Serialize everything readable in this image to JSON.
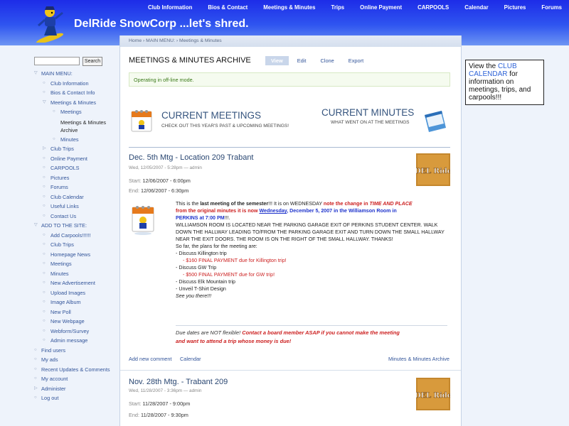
{
  "header": {
    "site_name": "DelRide SnowCorp ...let's shred.",
    "nav": [
      "Club Information",
      "Bios & Contact",
      "Meetings & Minutes",
      "Trips",
      "Online Payment",
      "CARPOOLS",
      "Calendar",
      "Pictures",
      "Forums"
    ]
  },
  "search": {
    "button": "Search",
    "value": ""
  },
  "sidebar": {
    "items": [
      {
        "label": "MAIN MENU:",
        "level": 0,
        "mk": "▽"
      },
      {
        "label": "Club Information",
        "level": 1,
        "mk": "○"
      },
      {
        "label": "Bios & Contact Info",
        "level": 1,
        "mk": "○"
      },
      {
        "label": "Meetings & Minutes",
        "level": 1,
        "mk": "▽"
      },
      {
        "label": "Meetings",
        "level": 2,
        "mk": "○"
      },
      {
        "label": "Meetings & Minutes Archive",
        "level": 2,
        "mk": "",
        "active": true
      },
      {
        "label": "Minutes",
        "level": 2,
        "mk": "○"
      },
      {
        "label": "Club Trips",
        "level": 1,
        "mk": "▷"
      },
      {
        "label": "Online Payment",
        "level": 1,
        "mk": "○"
      },
      {
        "label": "CARPOOLS",
        "level": 1,
        "mk": "○"
      },
      {
        "label": "Pictures",
        "level": 1,
        "mk": "○"
      },
      {
        "label": "Forums",
        "level": 1,
        "mk": "○"
      },
      {
        "label": "Club Calendar",
        "level": 1,
        "mk": "○"
      },
      {
        "label": "Useful Links",
        "level": 1,
        "mk": "○"
      },
      {
        "label": "Contact Us",
        "level": 1,
        "mk": "○"
      },
      {
        "label": "ADD TO THE SITE:",
        "level": 0,
        "mk": "▽"
      },
      {
        "label": "Add Carpools!!!!!!",
        "level": 1,
        "mk": "○"
      },
      {
        "label": "Club Trips",
        "level": 1,
        "mk": "○"
      },
      {
        "label": "Homepage News",
        "level": 1,
        "mk": "○"
      },
      {
        "label": "Meetings",
        "level": 1,
        "mk": "○"
      },
      {
        "label": "Minutes",
        "level": 1,
        "mk": "○"
      },
      {
        "label": "New Advertisement",
        "level": 1,
        "mk": "○"
      },
      {
        "label": "Upload Images",
        "level": 1,
        "mk": "○"
      },
      {
        "label": "Image Album",
        "level": 1,
        "mk": "○"
      },
      {
        "label": "New Poll",
        "level": 1,
        "mk": "○"
      },
      {
        "label": "New Webpage",
        "level": 1,
        "mk": "○"
      },
      {
        "label": "Webform/Survey",
        "level": 1,
        "mk": "○"
      },
      {
        "label": "Admin message",
        "level": 1,
        "mk": "○"
      },
      {
        "label": "Find users",
        "level": 0,
        "mk": "○"
      },
      {
        "label": "My ads",
        "level": 0,
        "mk": "○"
      },
      {
        "label": "Recent Updates & Comments",
        "level": 0,
        "mk": "○"
      },
      {
        "label": "My account",
        "level": 0,
        "mk": "○"
      },
      {
        "label": "Administer",
        "level": 0,
        "mk": "▷"
      },
      {
        "label": "Log out",
        "level": 0,
        "mk": "○"
      }
    ]
  },
  "main": {
    "breadcrumb": "Home › MAIN MENU: › Meetings & Minutes",
    "title": "MEETINGS & MINUTES ARCHIVE",
    "tabs": [
      "View",
      "Edit",
      "Clone",
      "Export"
    ],
    "status": "Operating in off-line mode.",
    "current_meetings": {
      "title": "CURRENT MEETINGS",
      "subtitle": "CHECK OUT THIS YEAR'S PAST & UPCOMING MEETINGS!"
    },
    "current_minutes": {
      "title": "CURRENT MINUTES",
      "subtitle": "WHAT WENT ON AT THE MEETINGS"
    }
  },
  "posts": [
    {
      "title": "Dec. 5th Mtg - Location 209 Trabant",
      "meta": "Wed, 12/05/2007 - 5:28pm — admin",
      "start_label": "Start:",
      "start": "12/06/2007 - 6:00pm",
      "end_label": "End:",
      "end": "12/06/2007 - 6:30pm",
      "logo_text": "DEL Ride",
      "body": {
        "p1a": "This is the ",
        "p1b": "last meeting of the semester",
        "p1c": "!!! It is on WEDNESDAY ",
        "p1d": "note the change in ",
        "p1e": "TIME AND PLACE",
        "p2a": "from the original minutes it is now ",
        "p2b": "Wednesday",
        "p2c": ", December 5, 2007 in the Williamson Room in",
        "p3a": "PERKINS at 7:00 PM",
        "p3b": "!!!.",
        "p4": "WILLIAMSON ROOM IS LOCATED NEAR THE PARKING GARAGE EXIT OF PERKINS STUDENT CENTER. WALK",
        "p5": "DOWN THE HALLWAY LEADING TO/FROM THE PARKING GARAGE EXIT AND TURN DOWN THE SMALL HALLWAY",
        "p6": "NEAR THE EXIT DOORS. THE ROOM IS ON THE RIGHT OF THE SMALL HALLWAY. THANKS!",
        "plans": "So far, the plans for the meeting are:",
        "l1": "- Discuss Killington trip",
        "l2": "- $160 FINAL PAYMENT due for Killington trip!",
        "l3": "- Discuss GW Trip",
        "l4": "- $500 FINAL PAYMENT due for GW trip!",
        "l5": "- Discuss Elk Mountain trip",
        "l6": "- Unveil T-Shirt Design",
        "l7": "See you there!!!",
        "n1a": "Due dates are NOT flexible! ",
        "n1b": "Contact a board member ASAP if you cannot make the meeting",
        "n2": "and want to attend a trip whose money is due!"
      },
      "links": {
        "add_comment": "Add new comment",
        "calendar": "Calendar",
        "archive": "Minutes & Minutes Archive"
      }
    },
    {
      "title": "Nov. 28th Mtg. - Trabant 209",
      "meta": "Wed, 11/28/2007 - 3:36pm — admin",
      "start_label": "Start:",
      "start": "11/28/2007 - 9:00pm",
      "end_label": "End:",
      "end": "11/28/2007 - 9:30pm",
      "logo_text": "DEL Ride"
    }
  ],
  "right_box": {
    "pre": "View the ",
    "link": "CLUB CALENDAR",
    "post": " for information on meetings, trips, and carpools!!!"
  },
  "colors": {
    "header_blue": "#2f55f0",
    "link_blue": "#33559a",
    "alert_red": "#cc1f1f",
    "status_green": "#3b7a19"
  }
}
